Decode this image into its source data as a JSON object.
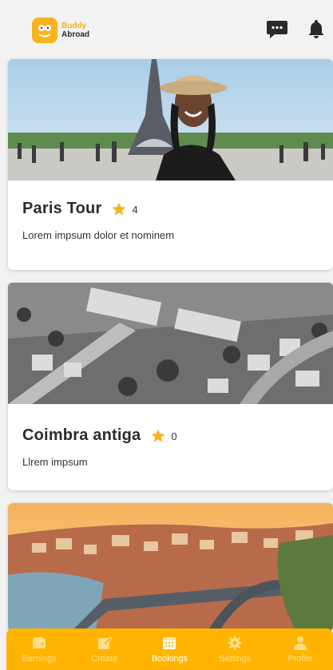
{
  "app": {
    "logo_line1": "Buddy",
    "logo_line2": "Abroad"
  },
  "colors": {
    "accent": "#ffb400",
    "star": "#f7b21c",
    "nav_inactive": "#ffe08a",
    "nav_active": "#ffffff"
  },
  "header": {
    "icons": [
      "chat-icon",
      "bell-icon"
    ]
  },
  "cards": [
    {
      "title": "Paris Tour",
      "rating": "4",
      "description": "Lorem impsum dolor et nominem",
      "image": "eiffel-tower-photo"
    },
    {
      "title": "Coimbra antiga",
      "rating": "0",
      "description": "Llrem impsum",
      "image": "coimbra-aerial-photo"
    },
    {
      "title": "",
      "rating": "",
      "description": "",
      "image": "porto-bridge-photo"
    }
  ],
  "nav": {
    "items": [
      {
        "label": "Earnings",
        "icon": "wallet-icon",
        "active": false
      },
      {
        "label": "Create",
        "icon": "edit-icon",
        "active": false
      },
      {
        "label": "Bookings",
        "icon": "calendar-icon",
        "active": true
      },
      {
        "label": "Settings",
        "icon": "gear-icon",
        "active": false
      },
      {
        "label": "Profile",
        "icon": "user-icon",
        "active": false
      }
    ]
  }
}
